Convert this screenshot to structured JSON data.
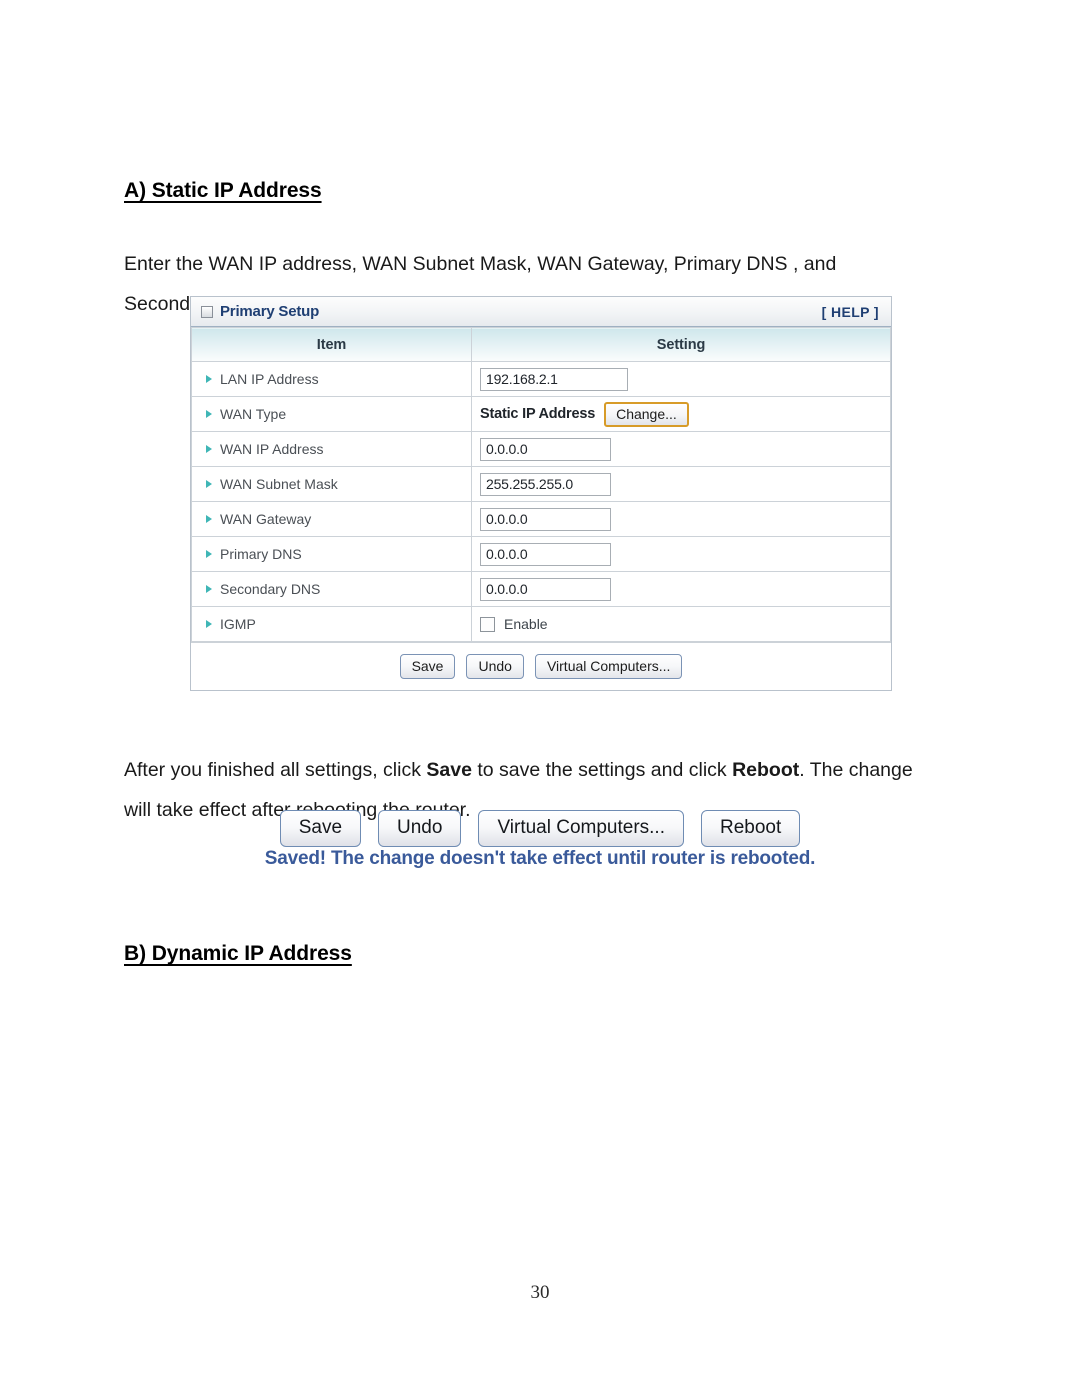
{
  "document": {
    "heading_a": "A) Static IP Address",
    "intro_paragraph": {
      "full_text": "Enter the WAN IP address, WAN Subnet Mask, WAN Gateway, Primary DNS , and Secondary DNS addresses provided by your ISP."
    },
    "after_paragraph": {
      "part1": "After you finished all settings, click ",
      "bold1": "Save",
      "part2": " to save the settings and click ",
      "bold2": "Reboot",
      "part3": ". The change will take effect after rebooting the router."
    },
    "heading_b": "B) Dynamic IP Address",
    "page_number": "30"
  },
  "router_panel": {
    "title": "Primary Setup",
    "title_icon": "window-square-icon",
    "help_label": "[ HELP ]",
    "columns": [
      "Item",
      "Setting"
    ],
    "rows": [
      {
        "label": "LAN IP Address",
        "control": "textbox",
        "value": "192.168.2.1",
        "width_class": "w-lan"
      },
      {
        "label": "WAN Type",
        "control": "label-button",
        "value": "Static IP Address",
        "button_label": "Change..."
      },
      {
        "label": "WAN IP Address",
        "control": "textbox",
        "value": "0.0.0.0",
        "width_class": "w-wan"
      },
      {
        "label": "WAN Subnet Mask",
        "control": "textbox",
        "value": "255.255.255.0",
        "width_class": "w-wan"
      },
      {
        "label": "WAN Gateway",
        "control": "textbox",
        "value": "0.0.0.0",
        "width_class": "w-wan"
      },
      {
        "label": "Primary DNS",
        "control": "textbox",
        "value": "0.0.0.0",
        "width_class": "w-wan"
      },
      {
        "label": "Secondary DNS",
        "control": "textbox",
        "value": "0.0.0.0",
        "width_class": "w-wan"
      },
      {
        "label": "IGMP",
        "control": "checkbox",
        "value": "Enable",
        "checked": false
      }
    ],
    "footer_buttons": [
      "Save",
      "Undo",
      "Virtual Computers..."
    ]
  },
  "button_strip": {
    "buttons": [
      "Save",
      "Undo",
      "Virtual Computers...",
      "Reboot"
    ],
    "status_message": "Saved! The change doesn't take effect until router is rebooted."
  },
  "colors": {
    "panel_title": "#1f3f73",
    "table_header_gradient_top": "#cfe7ec",
    "row_bullet": "#3fb6b6",
    "change_button_border": "#d79b28",
    "status_message": "#3a5a9a",
    "button_border": "#6f8cb3"
  }
}
